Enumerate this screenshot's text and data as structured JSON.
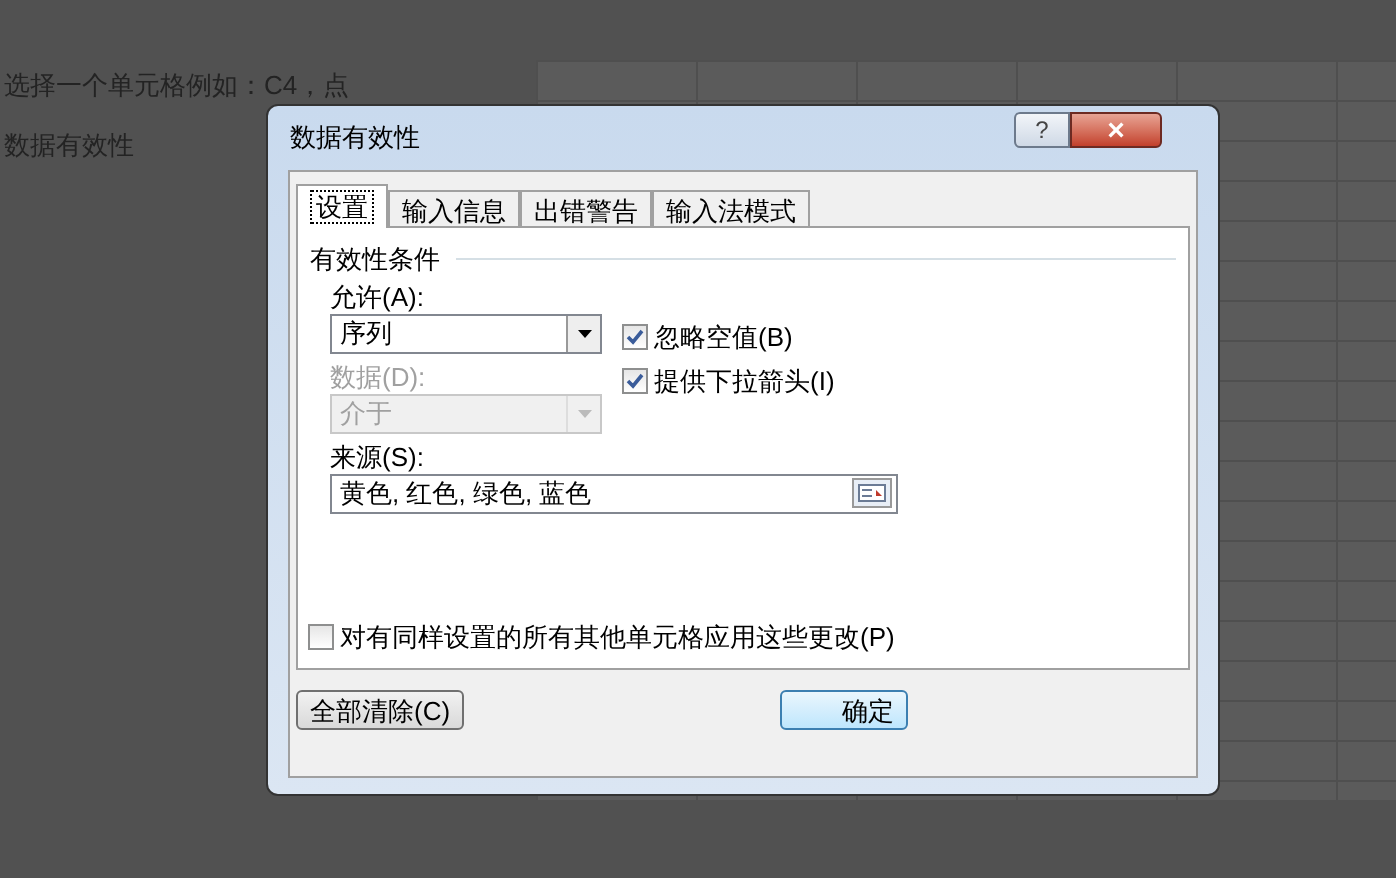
{
  "article": {
    "lines": [
      "选择一个单元格例如：C4，点",
      "数据有效性"
    ]
  },
  "dialog": {
    "title": "数据有效性",
    "help": "?",
    "close": "×",
    "tabs": [
      {
        "label": "设置",
        "selected": true
      },
      {
        "label": "输入信息",
        "selected": false
      },
      {
        "label": "出错警告",
        "selected": false
      },
      {
        "label": "输入法模式",
        "selected": false
      }
    ],
    "group_title": "有效性条件",
    "allow": {
      "label": "允许(A):",
      "value": "序列",
      "disabled": false
    },
    "data": {
      "label": "数据(D):",
      "value": "介于",
      "disabled": true
    },
    "checkboxes": [
      {
        "label": "忽略空值(B)",
        "checked": true
      },
      {
        "label": "提供下拉箭头(I)",
        "checked": true
      }
    ],
    "source": {
      "label": "来源(S):",
      "value": "黄色, 红色, 绿色, 蓝色"
    },
    "apply_all": {
      "label": "对有同样设置的所有其他单元格应用这些更改(P)",
      "checked": false
    },
    "buttons": {
      "clear": "全部清除(C)",
      "ok": "确定"
    }
  }
}
